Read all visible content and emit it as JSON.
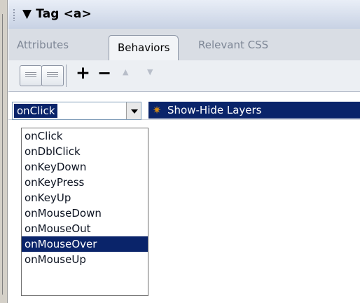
{
  "panel": {
    "title": "Tag <a>",
    "expand_glyph": "▼"
  },
  "tabs": [
    {
      "label": "Attributes",
      "active": false
    },
    {
      "label": "Behaviors",
      "active": true
    },
    {
      "label": "Relevant CSS",
      "active": false
    }
  ],
  "toolbar": {
    "show_set_events_icon": "grid-lines-icon",
    "show_all_events_icon": "list-lines-icon",
    "add_glyph": "+",
    "remove_glyph": "−",
    "up_glyph": "▲",
    "down_glyph": "▼"
  },
  "events": {
    "current": "onClick",
    "selected_action": "Show-Hide Layers",
    "options": [
      "onClick",
      "onDblClick",
      "onKeyDown",
      "onKeyPress",
      "onKeyUp",
      "onMouseDown",
      "onMouseOut",
      "onMouseOver",
      "onMouseUp"
    ],
    "highlighted_option": "onMouseOver"
  },
  "colors": {
    "selection": "#0a246a",
    "panel_header": "#c8d2e4"
  }
}
